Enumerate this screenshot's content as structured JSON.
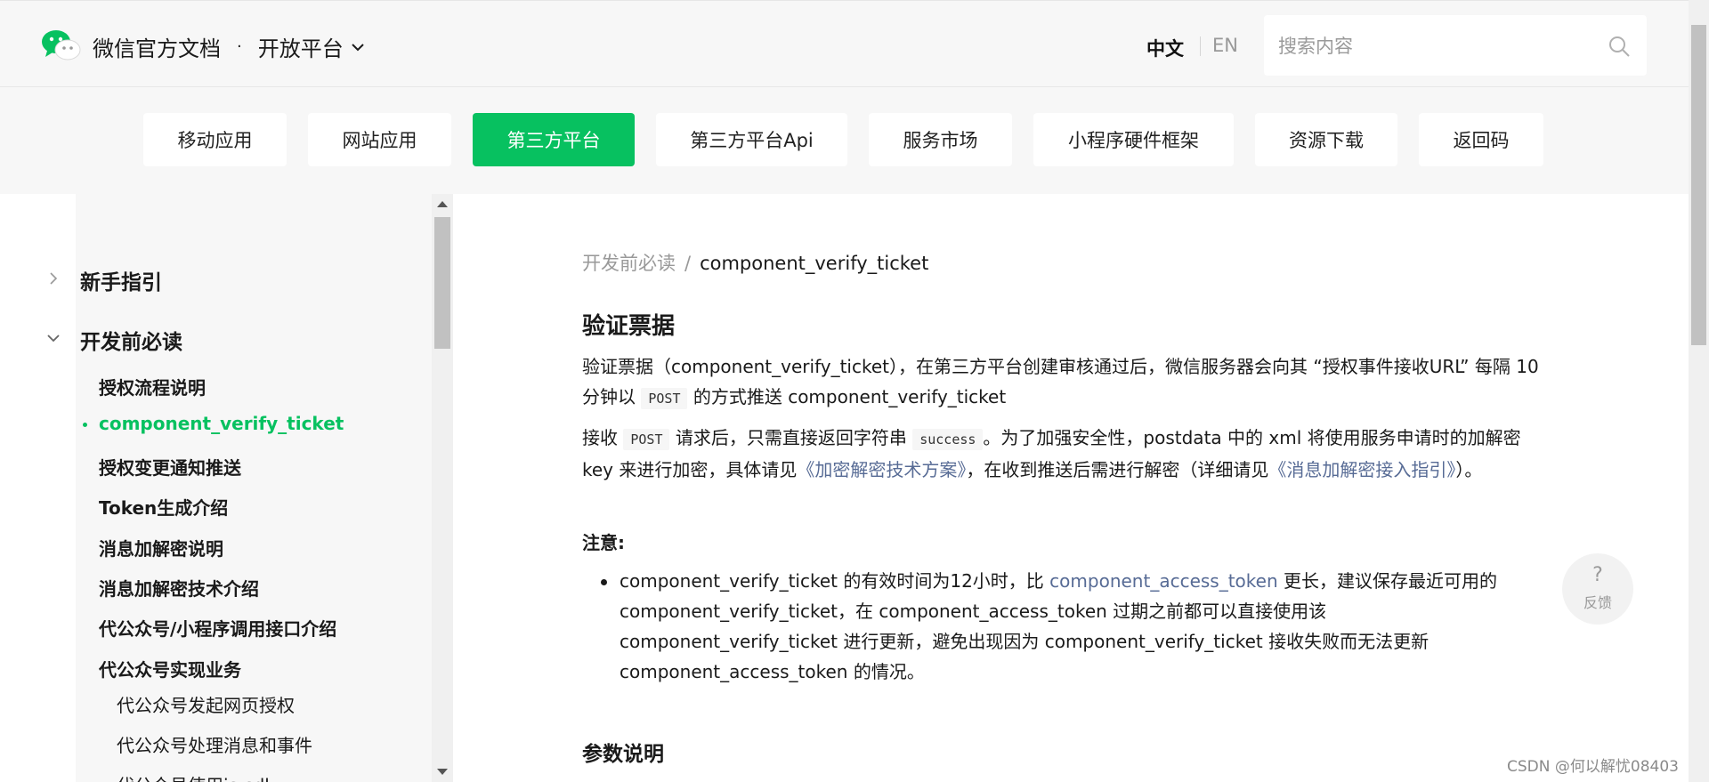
{
  "header": {
    "brand": "微信官方文档",
    "dot": "·",
    "section": "开放平台",
    "lang_zh": "中文",
    "lang_en": "EN",
    "search_placeholder": "搜索内容"
  },
  "tabs": [
    {
      "label": "移动应用",
      "active": false
    },
    {
      "label": "网站应用",
      "active": false
    },
    {
      "label": "第三方平台",
      "active": true
    },
    {
      "label": "第三方平台Api",
      "active": false
    },
    {
      "label": "服务市场",
      "active": false
    },
    {
      "label": "小程序硬件框架",
      "active": false
    },
    {
      "label": "资源下载",
      "active": false
    },
    {
      "label": "返回码",
      "active": false
    }
  ],
  "sidebar": {
    "groups": [
      {
        "label": "新手指引",
        "expanded": false
      },
      {
        "label": "开发前必读",
        "expanded": true
      }
    ],
    "items": [
      {
        "label": "授权流程说明"
      },
      {
        "label": "component_verify_ticket",
        "active": true
      },
      {
        "label": "授权变更通知推送"
      },
      {
        "label": "Token生成介绍"
      },
      {
        "label": "消息加解密说明"
      },
      {
        "label": "消息加解密技术介绍"
      },
      {
        "label": "代公众号/小程序调用接口介绍"
      },
      {
        "label": "代公众号实现业务"
      }
    ],
    "subitems": [
      {
        "label": "代公众号发起网页授权"
      },
      {
        "label": "代公众号处理消息和事件"
      },
      {
        "label": "代公众号使用js-sdk"
      }
    ]
  },
  "main": {
    "breadcrumb": {
      "parent": "开发前必读",
      "sep": "/",
      "current": "component_verify_ticket"
    },
    "title": "验证票据",
    "p1": {
      "a": "验证票据（component_verify_ticket），在第三方平台创建审核通过后，微信服务器会向其 “授权事件接收URL” 每隔 10 分钟以 ",
      "code": "POST",
      "b": " 的方式推送 component_verify_ticket"
    },
    "p2": {
      "a": "接收 ",
      "code1": "POST",
      "b": " 请求后，只需直接返回字符串 ",
      "code2": "success",
      "c": "。为了加强安全性，postdata 中的 xml 将使用服务申请时的加解密 key 来进行加密，具体请见",
      "link1": "《加密解密技术方案》",
      "d": "，在收到推送后需进行解密（详细请见",
      "link2": "《消息加解密接入指引》",
      "e": "）。"
    },
    "note_label": "注意:",
    "list_item": {
      "a": "component_verify_ticket 的有效时间为12小时，比 ",
      "link": "component_access_token",
      "b": " 更长，建议保存最近可用的 component_verify_ticket，在 component_access_token 过期之前都可以直接使用该 component_verify_ticket 进行更新，避免出现因为 component_verify_ticket 接收失败而无法更新 component_access_token 的情况。"
    },
    "section2": "参数说明"
  },
  "feedback": {
    "symbol": "?",
    "label": "反馈"
  },
  "watermark": "CSDN @何以解忧08403",
  "colors": {
    "accent": "#07c160",
    "link": "#576b95",
    "header_bg": "#f7f7f7"
  }
}
